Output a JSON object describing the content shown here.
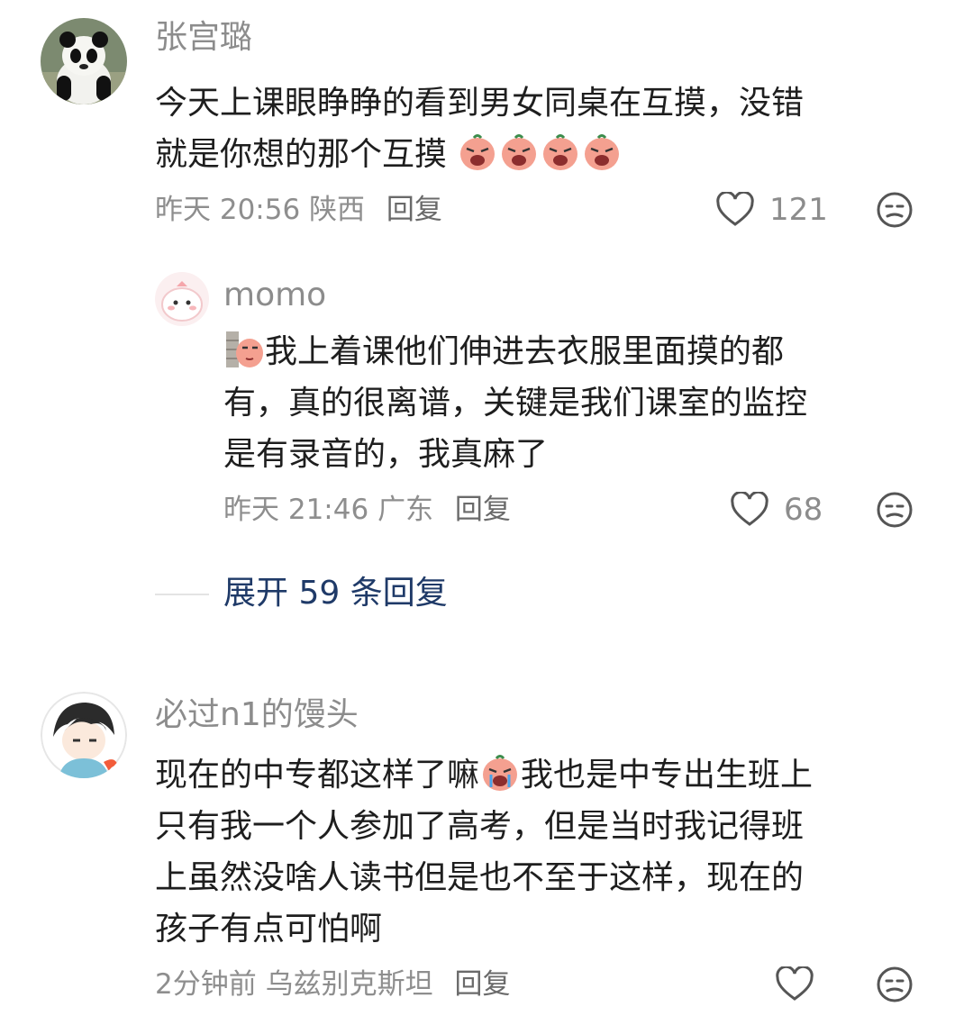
{
  "comments": [
    {
      "user": "张宫璐",
      "text_line1": "今天上课眼睁睁的看到男女同桌在互摸，没错",
      "text_line2": "就是你想的那个互摸",
      "time": "昨天 20:56",
      "location": "陕西",
      "reply_label": "回复",
      "likes": "121",
      "avatar_icon": "panda-avatar",
      "emoji_icon": "crying-sweet-potato-emoji"
    },
    {
      "user": "momo",
      "text_line1": "我上着课他们伸进去衣服里面摸的都",
      "text_line2": "有，真的很离谱，关键是我们课室的监控",
      "text_line3": "是有录音的，我真麻了",
      "time": "昨天 21:46",
      "location": "广东",
      "reply_label": "回复",
      "likes": "68",
      "avatar_icon": "pink-cartoon-avatar",
      "emoji_icon": "peeking-sweet-potato-emoji"
    },
    {
      "user": "必过n1的馒头",
      "text_line1_a": "现在的中专都这样了嘛",
      "text_line1_b": "我也是中专出生班上",
      "text_line2": "只有我一个人参加了高考，但是当时我记得班",
      "text_line3": "上虽然没啥人读书但是也不至于这样，现在的",
      "text_line4": "孩子有点可怕啊",
      "time": "2分钟前",
      "location": "乌兹别克斯坦",
      "reply_label": "回复",
      "avatar_icon": "anime-boy-avatar",
      "emoji_icon": "crying-sweet-potato-emoji"
    }
  ],
  "expand_replies": "展开 59 条回复",
  "colors": {
    "accent": "#1f3a68",
    "meta": "#8e8e8e",
    "emoji": "#f29a86"
  }
}
